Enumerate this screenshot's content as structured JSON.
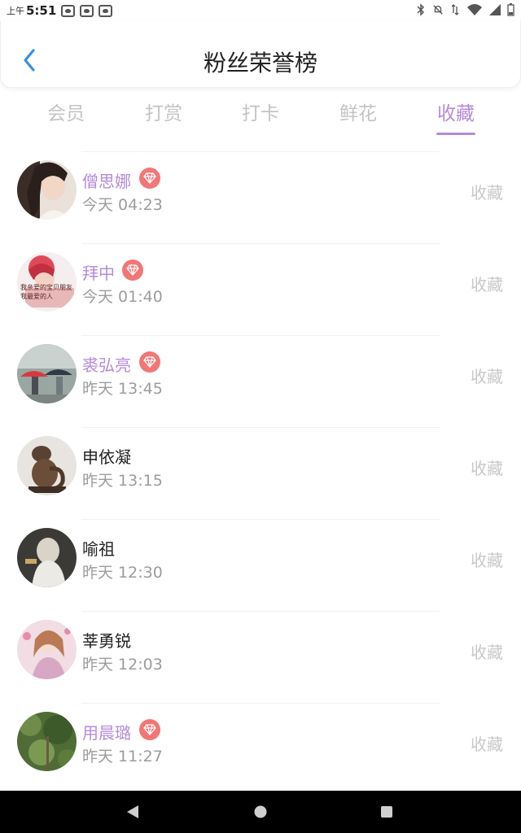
{
  "status": {
    "ampm": "上午",
    "time": "5:51"
  },
  "header": {
    "title": "粉丝荣誉榜"
  },
  "tabs": [
    {
      "label": "会员"
    },
    {
      "label": "打赏"
    },
    {
      "label": "打卡"
    },
    {
      "label": "鲜花"
    },
    {
      "label": "收藏"
    }
  ],
  "active_tab": "收藏",
  "list": [
    {
      "name": "僧思娜",
      "time": "今天 04:23",
      "action": "收藏",
      "vip": true
    },
    {
      "name": "拜中",
      "time": "今天 01:40",
      "action": "收藏",
      "vip": true
    },
    {
      "name": "裘弘亮",
      "time": "昨天 13:45",
      "action": "收藏",
      "vip": true
    },
    {
      "name": "申依凝",
      "time": "昨天 13:15",
      "action": "收藏",
      "vip": false
    },
    {
      "name": "喻祖",
      "time": "昨天 12:30",
      "action": "收藏",
      "vip": false
    },
    {
      "name": "莘勇锐",
      "time": "昨天 12:03",
      "action": "收藏",
      "vip": false
    },
    {
      "name": "用晨璐",
      "time": "昨天 11:27",
      "action": "收藏",
      "vip": true
    }
  ],
  "avatar_text": "我亲爱的宝贝朋友\n我最爱的人",
  "colors": {
    "accent": "#b48bd8",
    "vip_badge": "#f27676",
    "back_arrow": "#3a8ee6"
  }
}
